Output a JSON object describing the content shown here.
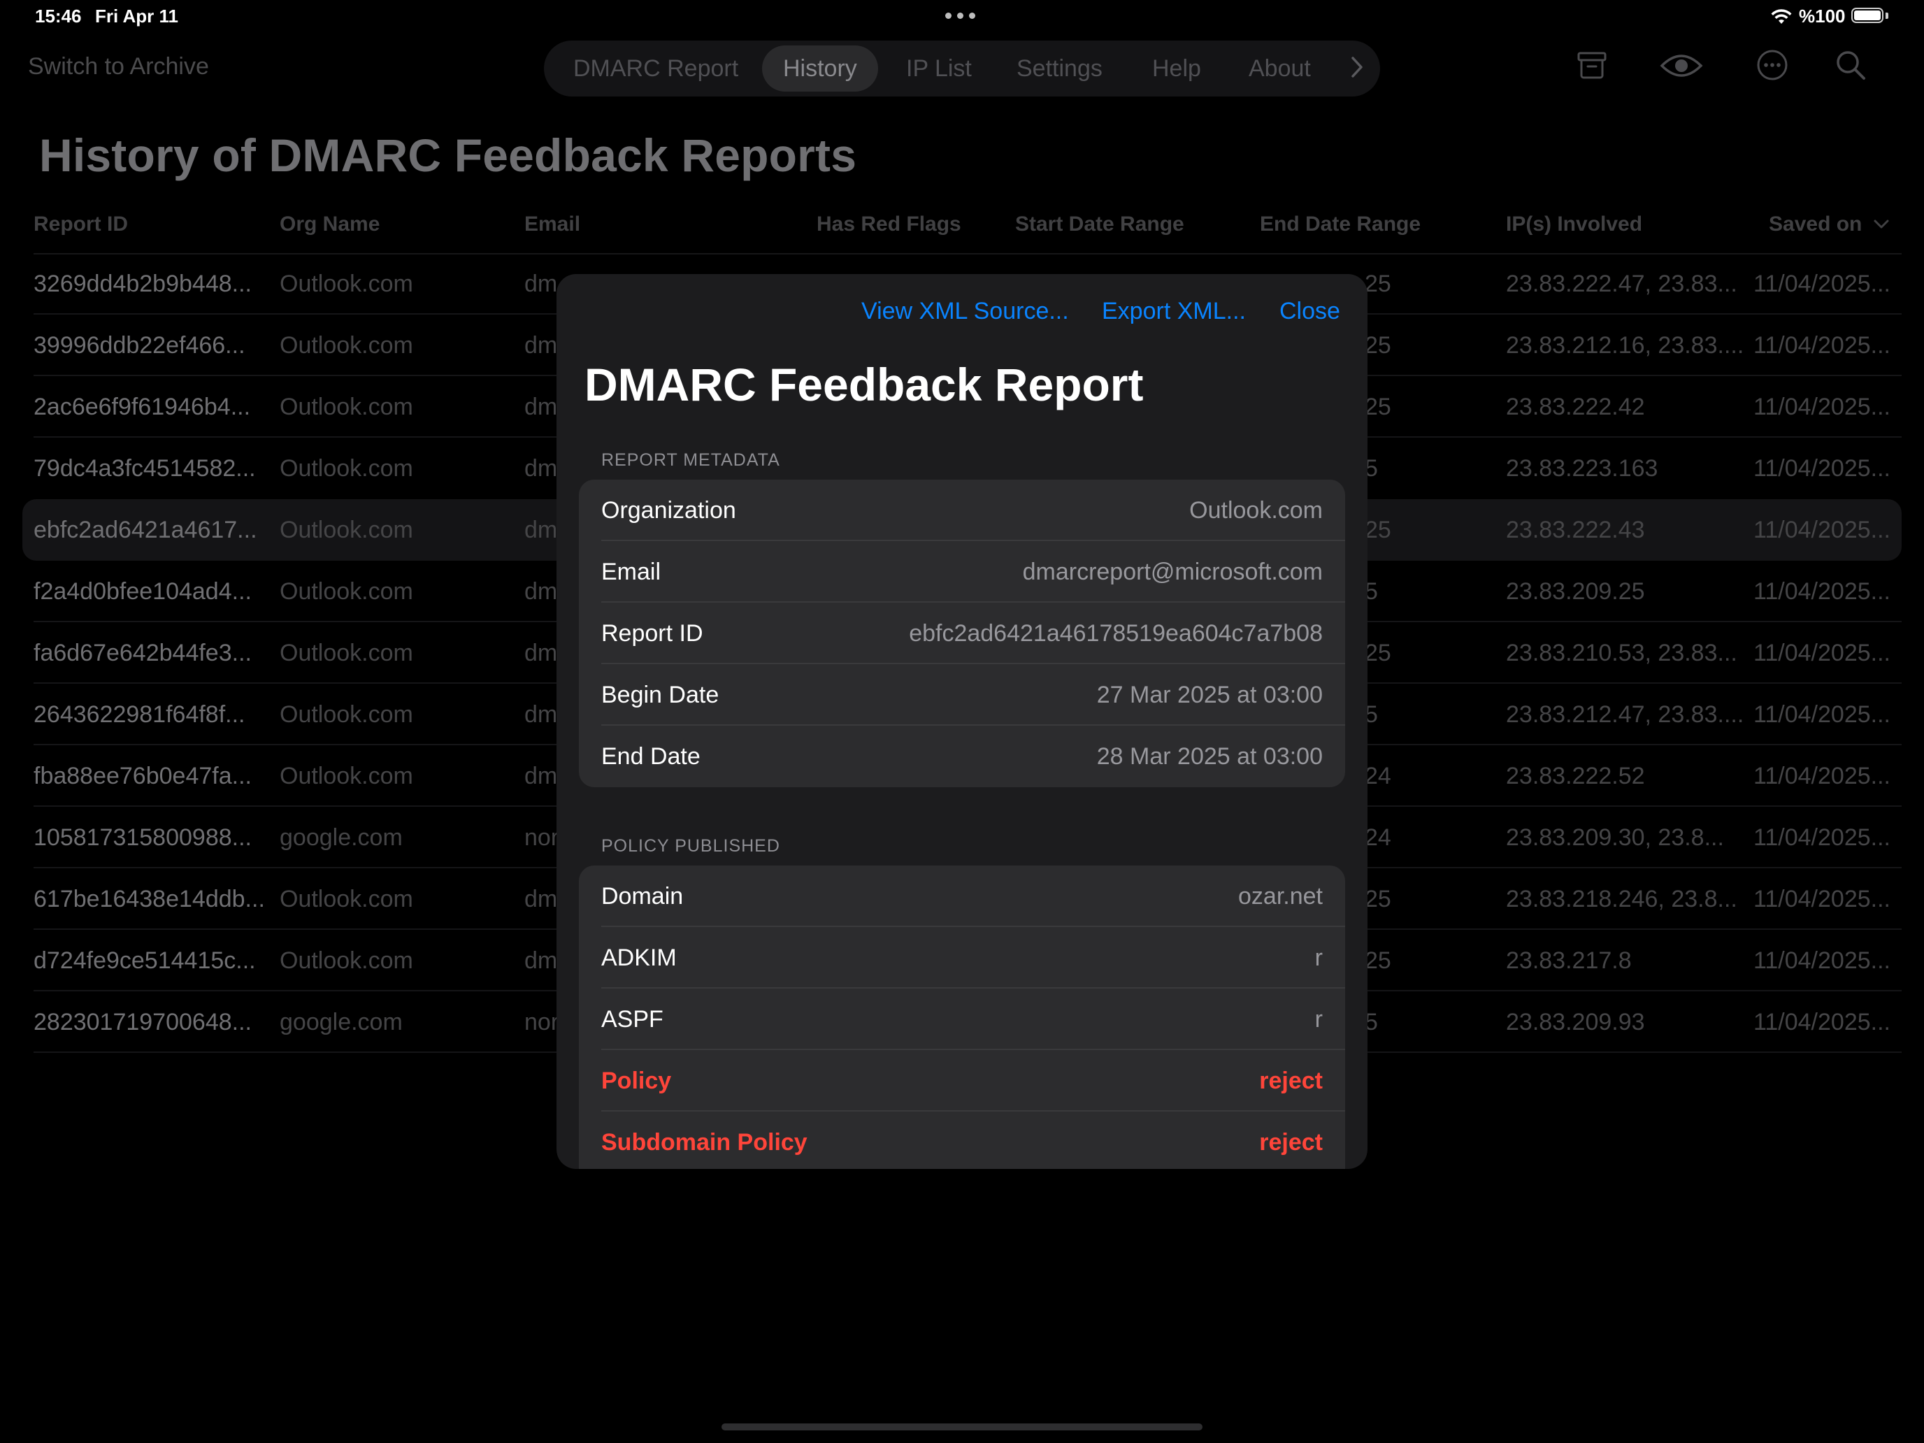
{
  "status_bar": {
    "time": "15:46",
    "date": "Fri Apr 11",
    "battery": "%100"
  },
  "nav": {
    "switch_archive": "Switch to Archive",
    "tabs": [
      "DMARC Report",
      "History",
      "IP List",
      "Settings",
      "Help",
      "About"
    ],
    "active_tab": "History"
  },
  "page": {
    "title": "History of DMARC Feedback Reports"
  },
  "table": {
    "columns": [
      "Report ID",
      "Org Name",
      "Email",
      "Has Red Flags",
      "Start Date Range",
      "End Date Range",
      "IP(s) Involved",
      "Saved on"
    ],
    "rows": [
      {
        "id": "3269dd4b2b9b448...",
        "org": "Outlook.com",
        "email": "dm",
        "end": "25",
        "ips": "23.83.222.47, 23.83...",
        "saved": "11/04/2025..."
      },
      {
        "id": "39996ddb22ef466...",
        "org": "Outlook.com",
        "email": "dm",
        "end": "25",
        "ips": "23.83.212.16, 23.83....",
        "saved": "11/04/2025..."
      },
      {
        "id": "2ac6e6f9f61946b4...",
        "org": "Outlook.com",
        "email": "dm",
        "end": "25",
        "ips": "23.83.222.42",
        "saved": "11/04/2025..."
      },
      {
        "id": "79dc4a3fc4514582...",
        "org": "Outlook.com",
        "email": "dm",
        "end": "5",
        "ips": "23.83.223.163",
        "saved": "11/04/2025..."
      },
      {
        "id": "ebfc2ad6421a4617...",
        "org": "Outlook.com",
        "email": "dm",
        "end": "25",
        "ips": "23.83.222.43",
        "saved": "11/04/2025..."
      },
      {
        "id": "f2a4d0bfee104ad4...",
        "org": "Outlook.com",
        "email": "dm",
        "end": "5",
        "ips": "23.83.209.25",
        "saved": "11/04/2025..."
      },
      {
        "id": "fa6d67e642b44fe3...",
        "org": "Outlook.com",
        "email": "dm",
        "end": "25",
        "ips": "23.83.210.53, 23.83...",
        "saved": "11/04/2025..."
      },
      {
        "id": "2643622981f64f8f...",
        "org": "Outlook.com",
        "email": "dm",
        "end": "5",
        "ips": "23.83.212.47, 23.83....",
        "saved": "11/04/2025..."
      },
      {
        "id": "fba88ee76b0e47fa...",
        "org": "Outlook.com",
        "email": "dm",
        "end": "24",
        "ips": "23.83.222.52",
        "saved": "11/04/2025..."
      },
      {
        "id": "105817315800988...",
        "org": "google.com",
        "email": "nor",
        "end": "24",
        "ips": "23.83.209.30, 23.8...",
        "saved": "11/04/2025..."
      },
      {
        "id": "617be16438e14ddb...",
        "org": "Outlook.com",
        "email": "dm",
        "end": "25",
        "ips": "23.83.218.246, 23.8...",
        "saved": "11/04/2025..."
      },
      {
        "id": "d724fe9ce514415c...",
        "org": "Outlook.com",
        "email": "dm",
        "end": "25",
        "ips": "23.83.217.8",
        "saved": "11/04/2025..."
      },
      {
        "id": "282301719700648...",
        "org": "google.com",
        "email": "nor",
        "end": "5",
        "ips": "23.83.209.93",
        "saved": "11/04/2025..."
      }
    ],
    "selected_row": 4
  },
  "modal": {
    "view_xml": "View XML Source...",
    "export_xml": "Export XML...",
    "close": "Close",
    "title": "DMARC Feedback Report",
    "metadata_header": "REPORT METADATA",
    "metadata": [
      {
        "label": "Organization",
        "value": "Outlook.com"
      },
      {
        "label": "Email",
        "value": "dmarcreport@microsoft.com"
      },
      {
        "label": "Report ID",
        "value": "ebfc2ad6421a46178519ea604c7a7b08"
      },
      {
        "label": "Begin Date",
        "value": "27 Mar 2025 at 03:00"
      },
      {
        "label": "End Date",
        "value": "28 Mar 2025 at 03:00"
      }
    ],
    "policy_header": "POLICY PUBLISHED",
    "policy": [
      {
        "label": "Domain",
        "value": "ozar.net",
        "flag": false
      },
      {
        "label": "ADKIM",
        "value": "r",
        "flag": false
      },
      {
        "label": "ASPF",
        "value": "r",
        "flag": false
      },
      {
        "label": "Policy",
        "value": "reject",
        "flag": true
      },
      {
        "label": "Subdomain Policy",
        "value": "reject",
        "flag": true
      }
    ]
  },
  "colors": {
    "accent": "#0a84ff",
    "danger": "#ff453a",
    "modal_bg": "#1c1c1e",
    "group_bg": "#2c2c2e"
  }
}
